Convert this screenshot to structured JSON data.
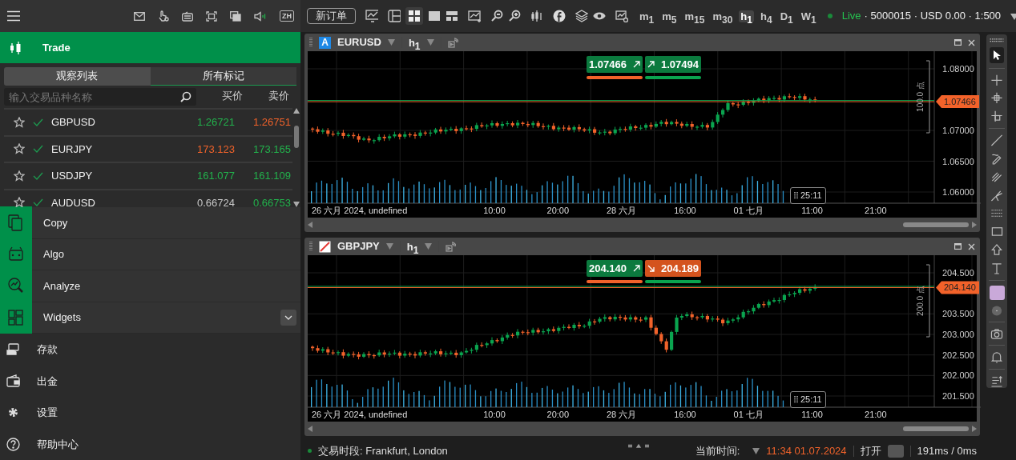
{
  "top_bar": {
    "language": "ZH"
  },
  "trade_menu": {
    "label": "Trade",
    "selected": true
  },
  "watchlist_tabs": [
    {
      "label": "观察列表",
      "selected": true
    },
    {
      "label": "所有标记",
      "selected": false
    }
  ],
  "search": {
    "placeholder": "输入交易品种名称"
  },
  "columns": [
    "买价",
    "卖价"
  ],
  "symbols": [
    {
      "name": "GBPUSD",
      "bid": {
        "value": "1.26721",
        "color": "#22b24c"
      },
      "ask": {
        "value": "1.26751",
        "color": "#f0622a"
      }
    },
    {
      "name": "EURJPY",
      "bid": {
        "value": "173.123",
        "color": "#f0622a"
      },
      "ask": {
        "value": "173.165",
        "color": "#22b24c"
      }
    },
    {
      "name": "USDJPY",
      "bid": {
        "value": "161.077",
        "color": "#22b24c"
      },
      "ask": {
        "value": "161.109",
        "color": "#22b24c"
      }
    },
    {
      "name": "AUDUSD",
      "bid": {
        "value": "0.66724",
        "color": "#c8c8c8"
      },
      "ask": {
        "value": "0.66753",
        "color": "#22b24c"
      }
    }
  ],
  "feature_menu": [
    {
      "label": "Copy",
      "kind": "copy"
    },
    {
      "label": "Algo",
      "kind": "algo"
    },
    {
      "label": "Analyze",
      "kind": "analyze"
    },
    {
      "label": "Widgets",
      "kind": "widgets"
    }
  ],
  "account_menu": [
    {
      "label": "存款",
      "kind": "deposit"
    },
    {
      "label": "出金",
      "kind": "withdraw"
    },
    {
      "label": "设置",
      "kind": "settings"
    },
    {
      "label": "帮助中心",
      "kind": "help"
    }
  ],
  "toolbar": {
    "new_order": "新订单",
    "timeframes": [
      {
        "unit": "m",
        "period": "1",
        "selected": false
      },
      {
        "unit": "m",
        "period": "5",
        "selected": false
      },
      {
        "unit": "m",
        "period": "15",
        "selected": false
      },
      {
        "unit": "m",
        "period": "30",
        "selected": false
      },
      {
        "unit": "h",
        "period": "1",
        "selected": true
      },
      {
        "unit": "h",
        "period": "4",
        "selected": false
      },
      {
        "unit": "D",
        "period": "1",
        "selected": false
      },
      {
        "unit": "W",
        "period": "1",
        "selected": false
      }
    ],
    "account": {
      "status": "Live",
      "details": "· 5000015 · USD 0.00 · 1:500"
    }
  },
  "charts": [
    {
      "badge": {
        "kind": "letter",
        "text": "A"
      },
      "symbol": "EURUSD",
      "timeframe": {
        "unit": "h",
        "period": "1"
      },
      "bid": {
        "value": "1.07466",
        "kind": "rising",
        "color": "#0b7a3e"
      },
      "ask": {
        "value": "1.07494",
        "kind": "rising",
        "color": "#0b7a3e"
      },
      "price_tag": "1.07466",
      "price_ticks": [
        "1.08000",
        "1.07000",
        "1.06500",
        "1.06000"
      ],
      "range_label": "100.0 点",
      "time_labels": [
        "26 六月 2024, undefined",
        "10:00",
        "20:00",
        "28 六月",
        "16:00",
        "01 七月",
        "11:00",
        "21:00"
      ],
      "countdown": "25:11"
    },
    {
      "badge": {
        "kind": "slash"
      },
      "symbol": "GBPJPY",
      "timeframe": {
        "unit": "h",
        "period": "1"
      },
      "bid": {
        "value": "204.140",
        "kind": "rising",
        "color": "#0b7a3e"
      },
      "ask": {
        "value": "204.189",
        "kind": "falling",
        "color": "#d4531e"
      },
      "price_tag": "204.140",
      "price_ticks": [
        "204.500",
        "203.500",
        "203.000",
        "202.500",
        "202.000",
        "201.500"
      ],
      "range_label": "200.0 点",
      "time_labels": [
        "26 六月 2024, undefined",
        "10:00",
        "20:00",
        "28 六月",
        "16:00",
        "01 七月",
        "11:00",
        "21:00"
      ],
      "countdown": "25:11"
    }
  ],
  "tools": {
    "color": "#c9a9d9"
  },
  "status_bar": {
    "session": "交易时段: Frankfurt, London",
    "time_label": "当前时间:",
    "time": "11:34 01.07.2024",
    "toggle_label": "打开",
    "toggle_on": false,
    "latency": "191ms / 0ms"
  }
}
